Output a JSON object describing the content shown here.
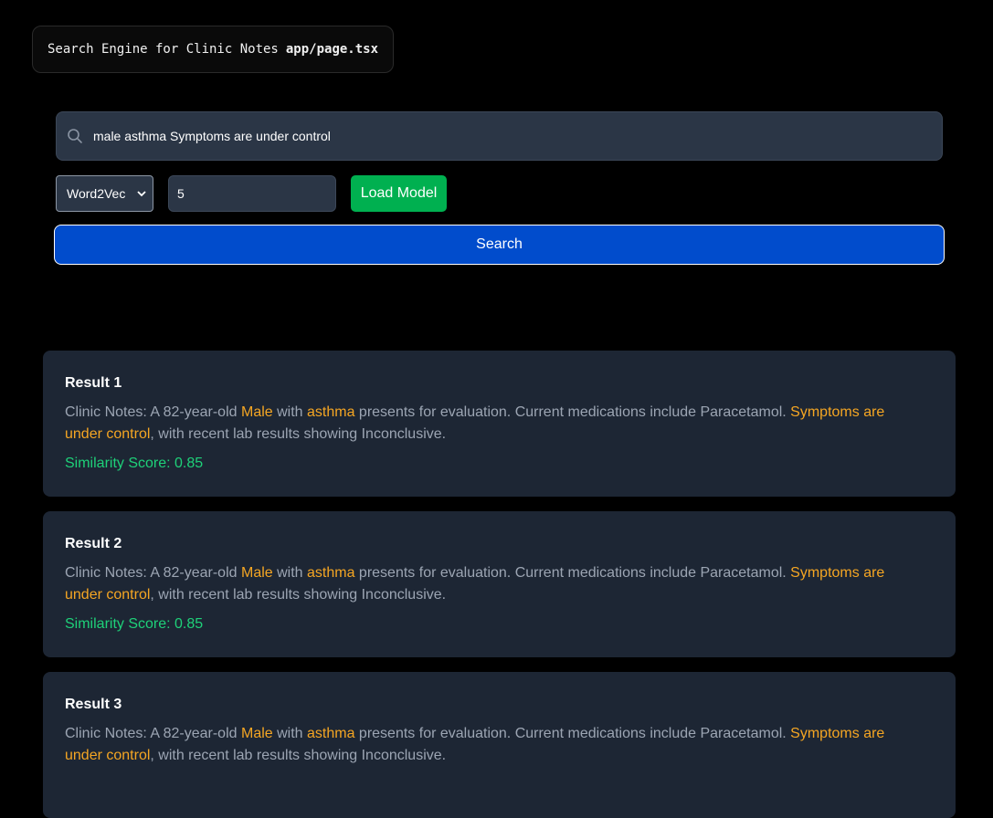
{
  "header": {
    "title": "Search Engine for Clinic Notes",
    "file": "app/page.tsx"
  },
  "search": {
    "query": "male asthma Symptoms are under control",
    "button_label": "Search"
  },
  "controls": {
    "model_selected": "Word2Vec",
    "top_k": "5",
    "load_model_label": "Load Model"
  },
  "colors": {
    "highlight": "#f5a623",
    "score": "#1ed179",
    "search_button": "#014ccc",
    "load_button": "#00b050"
  },
  "results": [
    {
      "title": "Result 1",
      "segments": [
        {
          "text": "Clinic Notes: A 82-year-old ",
          "hl": false
        },
        {
          "text": "Male",
          "hl": true
        },
        {
          "text": " with ",
          "hl": false
        },
        {
          "text": "asthma",
          "hl": true
        },
        {
          "text": " presents for evaluation. Current medications include Paracetamol. ",
          "hl": false
        },
        {
          "text": "Symptoms are under control",
          "hl": true
        },
        {
          "text": ", with recent lab results showing Inconclusive.",
          "hl": false
        }
      ],
      "score": "Similarity Score: 0.85"
    },
    {
      "title": "Result 2",
      "segments": [
        {
          "text": "Clinic Notes: A 82-year-old ",
          "hl": false
        },
        {
          "text": "Male",
          "hl": true
        },
        {
          "text": " with ",
          "hl": false
        },
        {
          "text": "asthma",
          "hl": true
        },
        {
          "text": " presents for evaluation. Current medications include Paracetamol. ",
          "hl": false
        },
        {
          "text": "Symptoms are under control",
          "hl": true
        },
        {
          "text": ", with recent lab results showing Inconclusive.",
          "hl": false
        }
      ],
      "score": "Similarity Score: 0.85"
    },
    {
      "title": "Result 3",
      "segments": [
        {
          "text": "Clinic Notes: A 82-year-old ",
          "hl": false
        },
        {
          "text": "Male",
          "hl": true
        },
        {
          "text": " with ",
          "hl": false
        },
        {
          "text": "asthma",
          "hl": true
        },
        {
          "text": " presents for evaluation. Current medications include Paracetamol. ",
          "hl": false
        },
        {
          "text": "Symptoms are under control",
          "hl": true
        },
        {
          "text": ", with recent lab results showing Inconclusive.",
          "hl": false
        }
      ],
      "score": ""
    }
  ]
}
